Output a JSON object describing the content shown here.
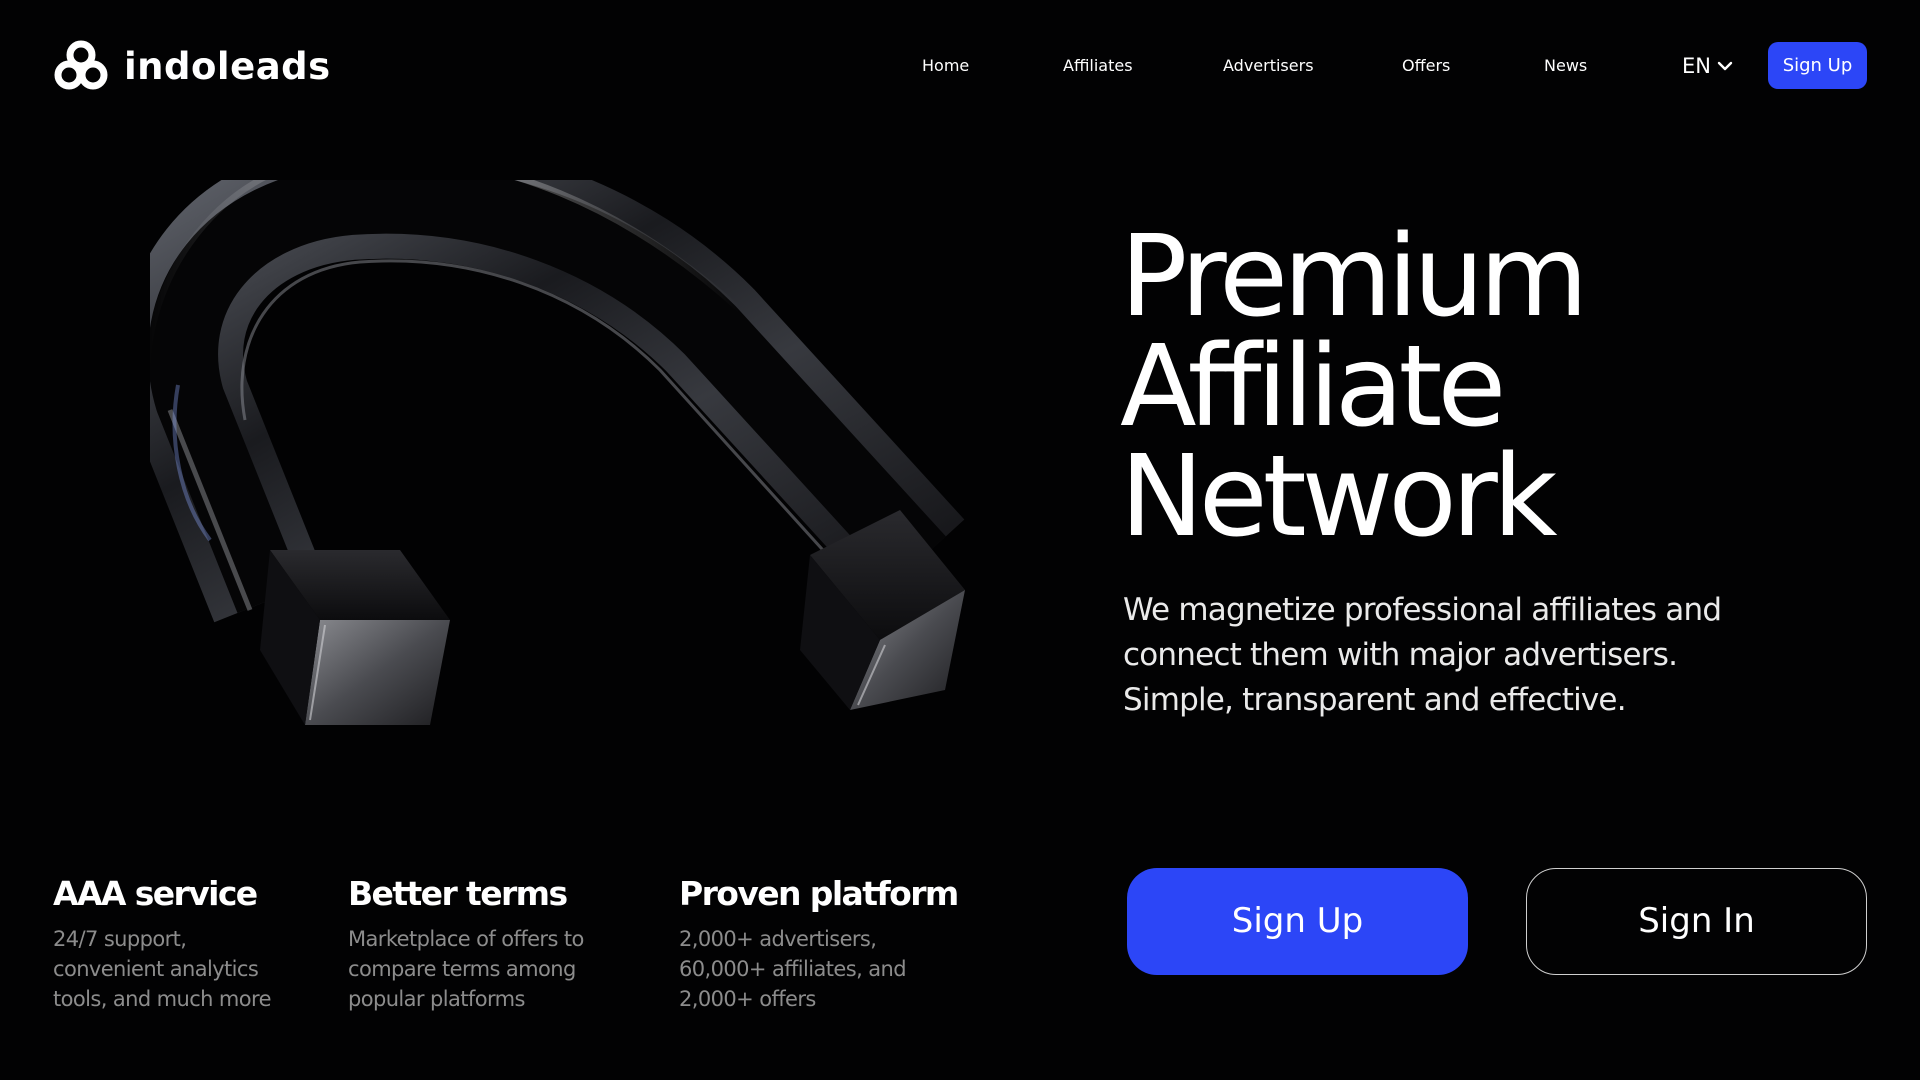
{
  "brand": {
    "name": "indoleads",
    "icon": "interlocked-rings-logo-icon"
  },
  "nav": {
    "items": [
      {
        "label": "Home"
      },
      {
        "label": "Affiliates"
      },
      {
        "label": "Advertisers"
      },
      {
        "label": "Offers"
      },
      {
        "label": "News"
      }
    ],
    "language": "EN",
    "language_icon": "chevron-down-icon",
    "signup_label": "Sign Up"
  },
  "hero": {
    "title_lines": [
      "Premium",
      "Affiliate",
      "Network"
    ],
    "subtitle_lines": [
      "We magnetize professional affiliates and",
      "connect them with major advertisers.",
      "Simple, transparent and effective."
    ],
    "visual": "glass-horseshoe-magnet"
  },
  "features": [
    {
      "title": "AAA service",
      "desc_lines": [
        "24/7 support,",
        "convenient analytics",
        "tools, and much more"
      ]
    },
    {
      "title": "Better terms",
      "desc_lines": [
        "Marketplace of offers to",
        "compare terms among",
        "popular platforms"
      ]
    },
    {
      "title": "Proven platform",
      "desc_lines": [
        "2,000+ advertisers,",
        "60,000+ affiliates, and",
        "2,000+ offers"
      ]
    }
  ],
  "cta": {
    "signup_label": "Sign Up",
    "signin_label": "Sign In"
  },
  "colors": {
    "background": "#020203",
    "accent": "#2c46f7",
    "text": "#ffffff",
    "muted_text": "#8c8c8c"
  }
}
